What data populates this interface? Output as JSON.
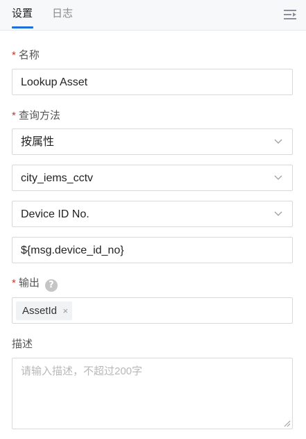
{
  "tabs": [
    {
      "label": "设置",
      "active": true
    },
    {
      "label": "日志",
      "active": false
    }
  ],
  "icons": {
    "menu": "collapse-menu-icon",
    "chevron": "chevron-down-icon",
    "help": "help-icon",
    "close": "close-icon"
  },
  "colors": {
    "accent": "#1e6fdc",
    "required": "#c0392b"
  },
  "form": {
    "required_mark": "*",
    "name": {
      "label": "名称",
      "value": "Lookup Asset"
    },
    "query_method": {
      "label": "查询方法",
      "method": "按属性",
      "collection": "city_iems_cctv",
      "attribute": "Device ID No.",
      "expression": "${msg.device_id_no}"
    },
    "output": {
      "label": "输出",
      "help": "?",
      "tags": [
        {
          "label": "AssetId",
          "close": "×"
        }
      ]
    },
    "description": {
      "label": "描述",
      "placeholder": "请输入描述，不超过200字"
    }
  }
}
